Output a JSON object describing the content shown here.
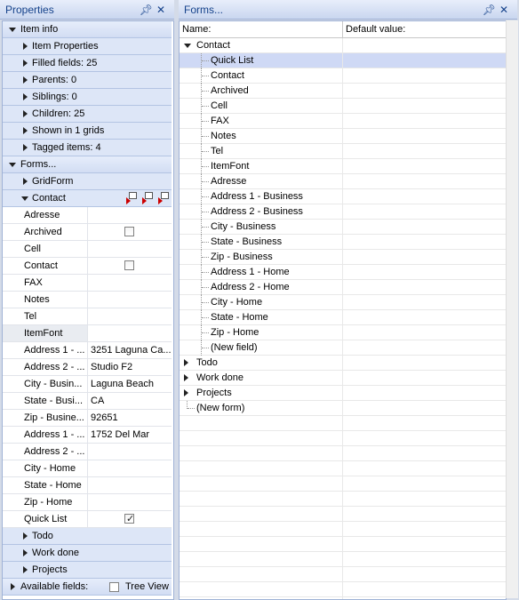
{
  "left_panel": {
    "title": "Properties",
    "pin": "ᵖ",
    "close": "✕",
    "item_info": "Item info",
    "item_properties": "Item Properties",
    "filled_fields": "Filled fields: 25",
    "parents": "Parents: 0",
    "siblings": "Siblings: 0",
    "children": "Children: 25",
    "shown_in": "Shown in 1 grids",
    "tagged": "Tagged items: 4",
    "forms": "Forms...",
    "gridform": "GridForm",
    "contact": "Contact",
    "fields": [
      {
        "name": "Adresse",
        "value": ""
      },
      {
        "name": "Archived",
        "value": "",
        "checkbox": true,
        "checked": false
      },
      {
        "name": "Cell",
        "value": ""
      },
      {
        "name": "Contact",
        "value": "",
        "checkbox": true,
        "checked": false
      },
      {
        "name": "FAX",
        "value": ""
      },
      {
        "name": "Notes",
        "value": ""
      },
      {
        "name": "Tel",
        "value": ""
      },
      {
        "name": "ItemFont",
        "value": "",
        "highlight": true
      },
      {
        "name": "Address 1 - ...",
        "value": "3251 Laguna Ca..."
      },
      {
        "name": "Address 2 - ...",
        "value": "Studio F2"
      },
      {
        "name": "City - Busin...",
        "value": "Laguna Beach"
      },
      {
        "name": "State - Busi...",
        "value": "CA"
      },
      {
        "name": "Zip - Busine...",
        "value": "92651"
      },
      {
        "name": "Address 1 - ...",
        "value": "1752 Del Mar"
      },
      {
        "name": "Address 2 - ...",
        "value": ""
      },
      {
        "name": "City - Home",
        "value": ""
      },
      {
        "name": "State - Home",
        "value": ""
      },
      {
        "name": "Zip - Home",
        "value": ""
      },
      {
        "name": "Quick List",
        "value": "",
        "checkbox": true,
        "checked": true
      }
    ],
    "todo": "Todo",
    "work_done": "Work done",
    "projects": "Projects",
    "available_fields": "Available fields:",
    "tree_view": "Tree View"
  },
  "right_panel": {
    "title": "Forms...",
    "pin": "ᵖ",
    "close": "✕",
    "col_name": "Name:",
    "col_default": "Default value:",
    "contact_form": "Contact",
    "fields": [
      "Quick List",
      "Contact",
      "Archived",
      "Cell",
      "FAX",
      "Notes",
      "Tel",
      "ItemFont",
      "Adresse",
      "Address 1 - Business",
      "Address 2 - Business",
      "City - Business",
      "State - Business",
      "Zip - Business",
      "Address 1 - Home",
      "Address 2 - Home",
      "City - Home",
      "State - Home",
      "Zip - Home",
      "(New field)"
    ],
    "other_forms": [
      "Todo",
      "Work done",
      "Projects"
    ],
    "new_form": "(New form)"
  }
}
